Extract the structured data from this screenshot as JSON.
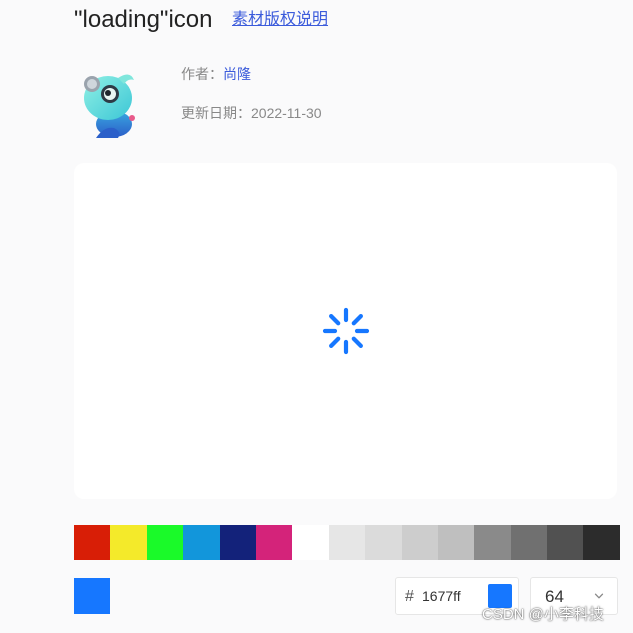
{
  "header": {
    "title": "\"loading\"icon",
    "license_link": "素材版权说明"
  },
  "meta": {
    "author_label": "作者：",
    "author_name": "尚隆",
    "date_label": "更新日期：",
    "date_value": "2022-11-30"
  },
  "preview": {
    "icon": "loading-spinner-icon",
    "icon_color": "#1677ff"
  },
  "palette": {
    "colors": [
      "#d81e06",
      "#f4ea2a",
      "#1afa29",
      "#1296db",
      "#13227a",
      "#d4237a",
      "#ffffff",
      "#e6e6e6",
      "#dbdbdb",
      "#cdcdcd",
      "#bfbfbf",
      "#8a8a8a",
      "#707070",
      "#515151",
      "#2c2c2c"
    ]
  },
  "color_picker": {
    "current_color": "#1677ff",
    "hash": "#",
    "hex_value": "1677ff"
  },
  "size_select": {
    "value": "64"
  },
  "watermark": "CSDN @小李科技"
}
